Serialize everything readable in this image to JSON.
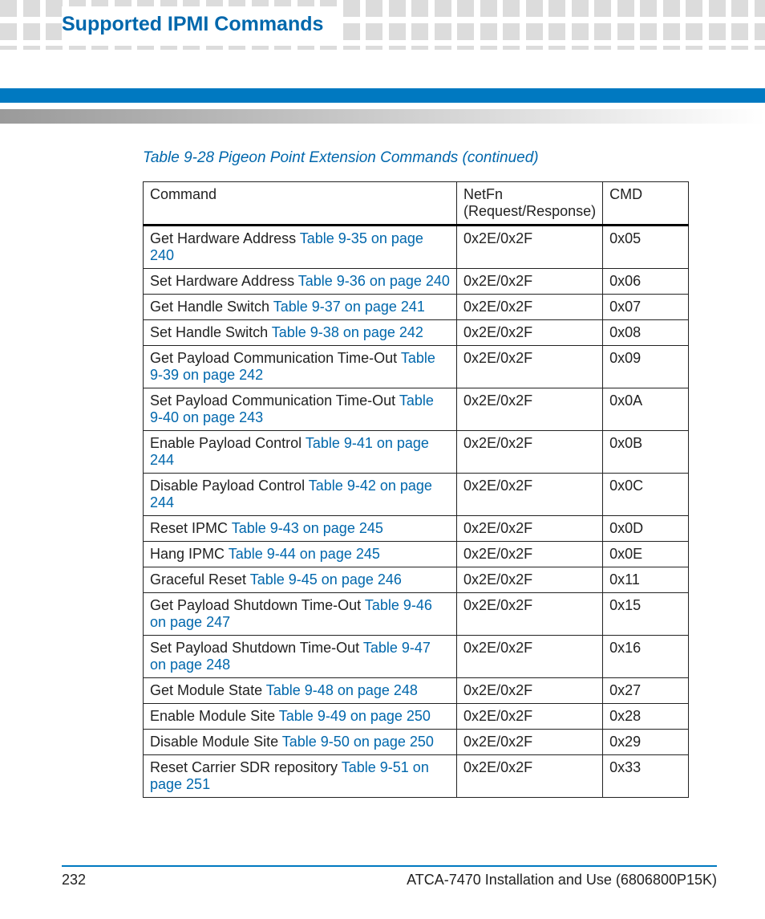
{
  "heading": "Supported IPMI Commands",
  "table_caption": "Table 9-28 Pigeon Point Extension Commands (continued)",
  "columns": {
    "c1a": "Command",
    "c2a": "NetFn",
    "c2b": "(Request/Response)",
    "c3a": "CMD"
  },
  "rows": [
    {
      "cmd": "Get Hardware Address ",
      "xref": "Table 9-35 on page 240",
      "netfn": "0x2E/0x2F",
      "code": "0x05"
    },
    {
      "cmd": "Set Hardware Address ",
      "xref": "Table 9-36 on page 240",
      "netfn": "0x2E/0x2F",
      "code": "0x06"
    },
    {
      "cmd": "Get Handle Switch ",
      "xref": "Table 9-37 on page 241",
      "netfn": "0x2E/0x2F",
      "code": "0x07"
    },
    {
      "cmd": "Set Handle Switch ",
      "xref": "Table 9-38 on page 242",
      "netfn": "0x2E/0x2F",
      "code": "0x08"
    },
    {
      "cmd": "Get Payload Communication Time-Out ",
      "xref": "Table 9-39 on page 242",
      "netfn": "0x2E/0x2F",
      "code": "0x09"
    },
    {
      "cmd": "Set Payload Communication Time-Out ",
      "xref": "Table 9-40 on page 243",
      "netfn": "0x2E/0x2F",
      "code": "0x0A"
    },
    {
      "cmd": "Enable Payload Control ",
      "xref": "Table 9-41 on page 244",
      "netfn": "0x2E/0x2F",
      "code": "0x0B"
    },
    {
      "cmd": "Disable Payload Control ",
      "xref": "Table 9-42 on page 244",
      "netfn": "0x2E/0x2F",
      "code": "0x0C"
    },
    {
      "cmd": "Reset IPMC ",
      "xref": "Table 9-43 on page 245",
      "netfn": "0x2E/0x2F",
      "code": "0x0D"
    },
    {
      "cmd": "Hang IPMC ",
      "xref": "Table 9-44 on page 245",
      "netfn": "0x2E/0x2F",
      "code": "0x0E"
    },
    {
      "cmd": "Graceful Reset ",
      "xref": "Table 9-45 on page 246",
      "netfn": "0x2E/0x2F",
      "code": "0x11"
    },
    {
      "cmd": "Get Payload Shutdown Time-Out ",
      "xref": "Table 9-46 on page 247",
      "netfn": "0x2E/0x2F",
      "code": "0x15"
    },
    {
      "cmd": "Set Payload Shutdown Time-Out ",
      "xref": "Table 9-47 on page 248",
      "netfn": "0x2E/0x2F",
      "code": "0x16"
    },
    {
      "cmd": "Get Module State ",
      "xref": "Table 9-48 on page 248",
      "netfn": "0x2E/0x2F",
      "code": "0x27"
    },
    {
      "cmd": "Enable Module Site ",
      "xref": "Table 9-49 on page 250",
      "netfn": "0x2E/0x2F",
      "code": "0x28"
    },
    {
      "cmd": "Disable Module Site ",
      "xref": "Table 9-50 on page 250",
      "netfn": "0x2E/0x2F",
      "code": "0x29"
    },
    {
      "cmd": "Reset Carrier SDR repository ",
      "xref": "Table 9-51 on page 251",
      "netfn": "0x2E/0x2F",
      "code": "0x33"
    }
  ],
  "footer": {
    "page": "232",
    "doc": "ATCA-7470 Installation and Use (6806800P15K)"
  }
}
